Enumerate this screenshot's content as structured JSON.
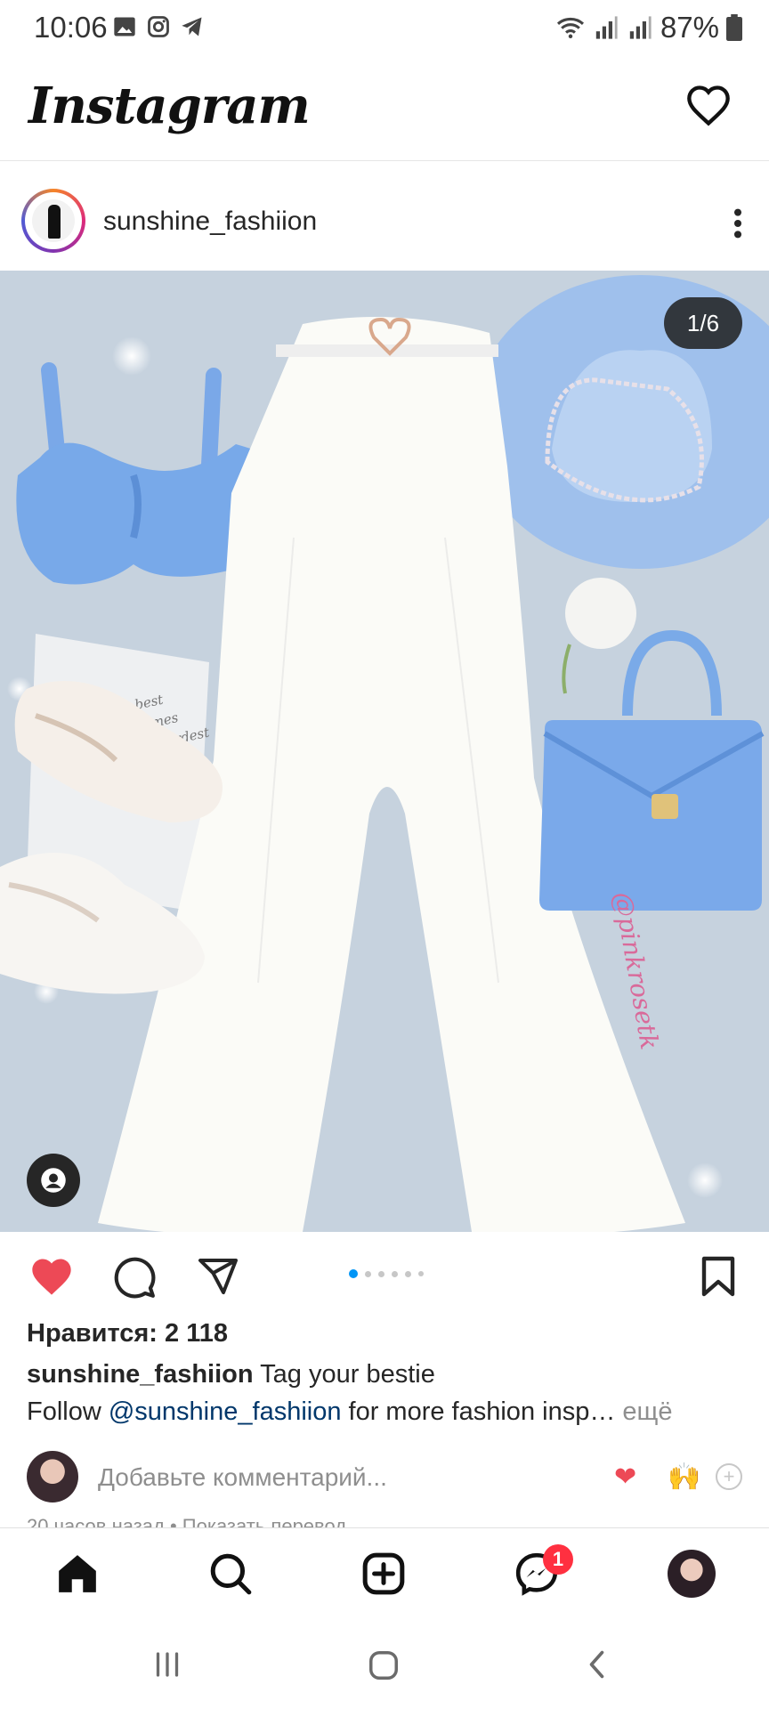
{
  "status_bar": {
    "time": "10:06",
    "battery": "87%"
  },
  "header": {
    "app_name": "Instagram"
  },
  "post": {
    "username": "sunshine_fashiion",
    "slide_counter": "1/6",
    "slide_current": 1,
    "slide_total": 6,
    "watermark": "@pinkrosetk",
    "likes": "Нравится: 2 118",
    "caption_user": "sunshine_fashiion",
    "caption_text": "Tag your bestie",
    "caption_line2_prefix": "Follow ",
    "caption_mention": "@sunshine_fashiion",
    "caption_line2_suffix": " for more fashion insp…",
    "more_label": "ещё",
    "comment_placeholder": "Добавьте комментарий...",
    "quick_reactions": [
      "❤",
      "🙌"
    ],
    "timestamp": "20 часов назад • Показать перевод"
  },
  "bottom_nav": {
    "items": [
      "home",
      "search",
      "new-post",
      "messenger",
      "profile"
    ],
    "messenger_badge": "1"
  },
  "colors": {
    "like": "#ed4956",
    "accent": "#0095f6",
    "mention": "#00376b",
    "photo_bg": "#c6d2de"
  }
}
